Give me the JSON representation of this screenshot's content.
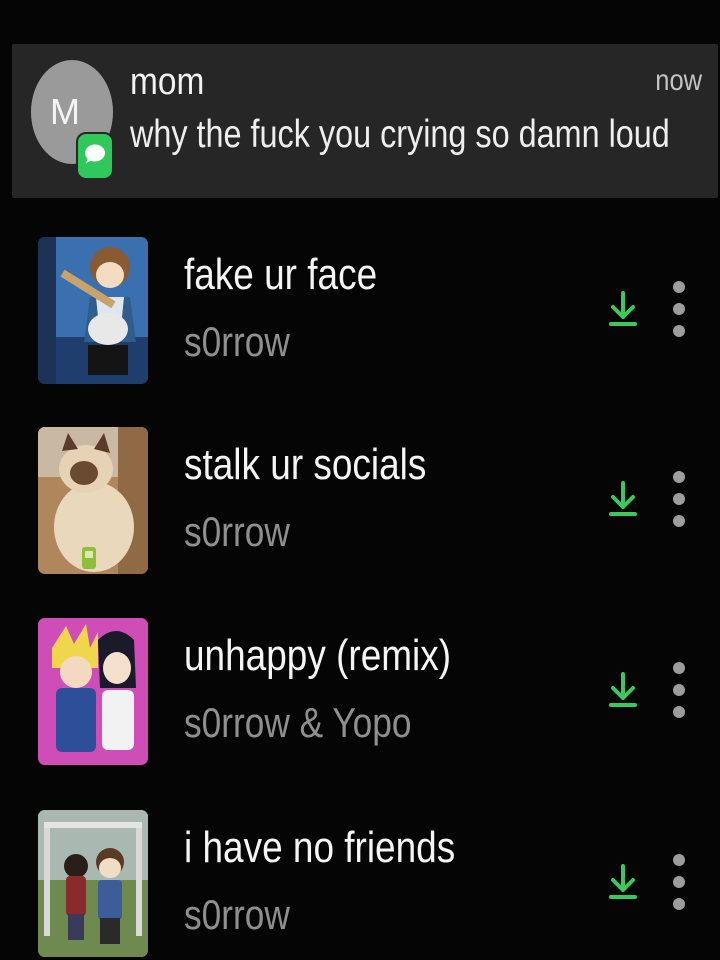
{
  "notification": {
    "avatar_letter": "M",
    "sender": "mom",
    "message": "why the fuck you crying so damn loud",
    "time": "now",
    "badge_icon": "message-bubble-icon",
    "badge_color": "#2fc85a"
  },
  "songs": [
    {
      "title": "fake ur face",
      "artist": "s0rrow",
      "cover_icon": "album-art-guitar-boy"
    },
    {
      "title": "stalk ur socials",
      "artist": "s0rrow",
      "cover_icon": "album-art-cat"
    },
    {
      "title": "unhappy (remix)",
      "artist": "s0rrow & Yopo",
      "cover_icon": "album-art-anime-pair"
    },
    {
      "title": "i have no friends",
      "artist": "s0rrow",
      "cover_icon": "album-art-playground"
    }
  ],
  "colors": {
    "background": "#050505",
    "notification_bg": "#262626",
    "download_green": "#3cc85c",
    "artist_gray": "#8f8f8f"
  }
}
